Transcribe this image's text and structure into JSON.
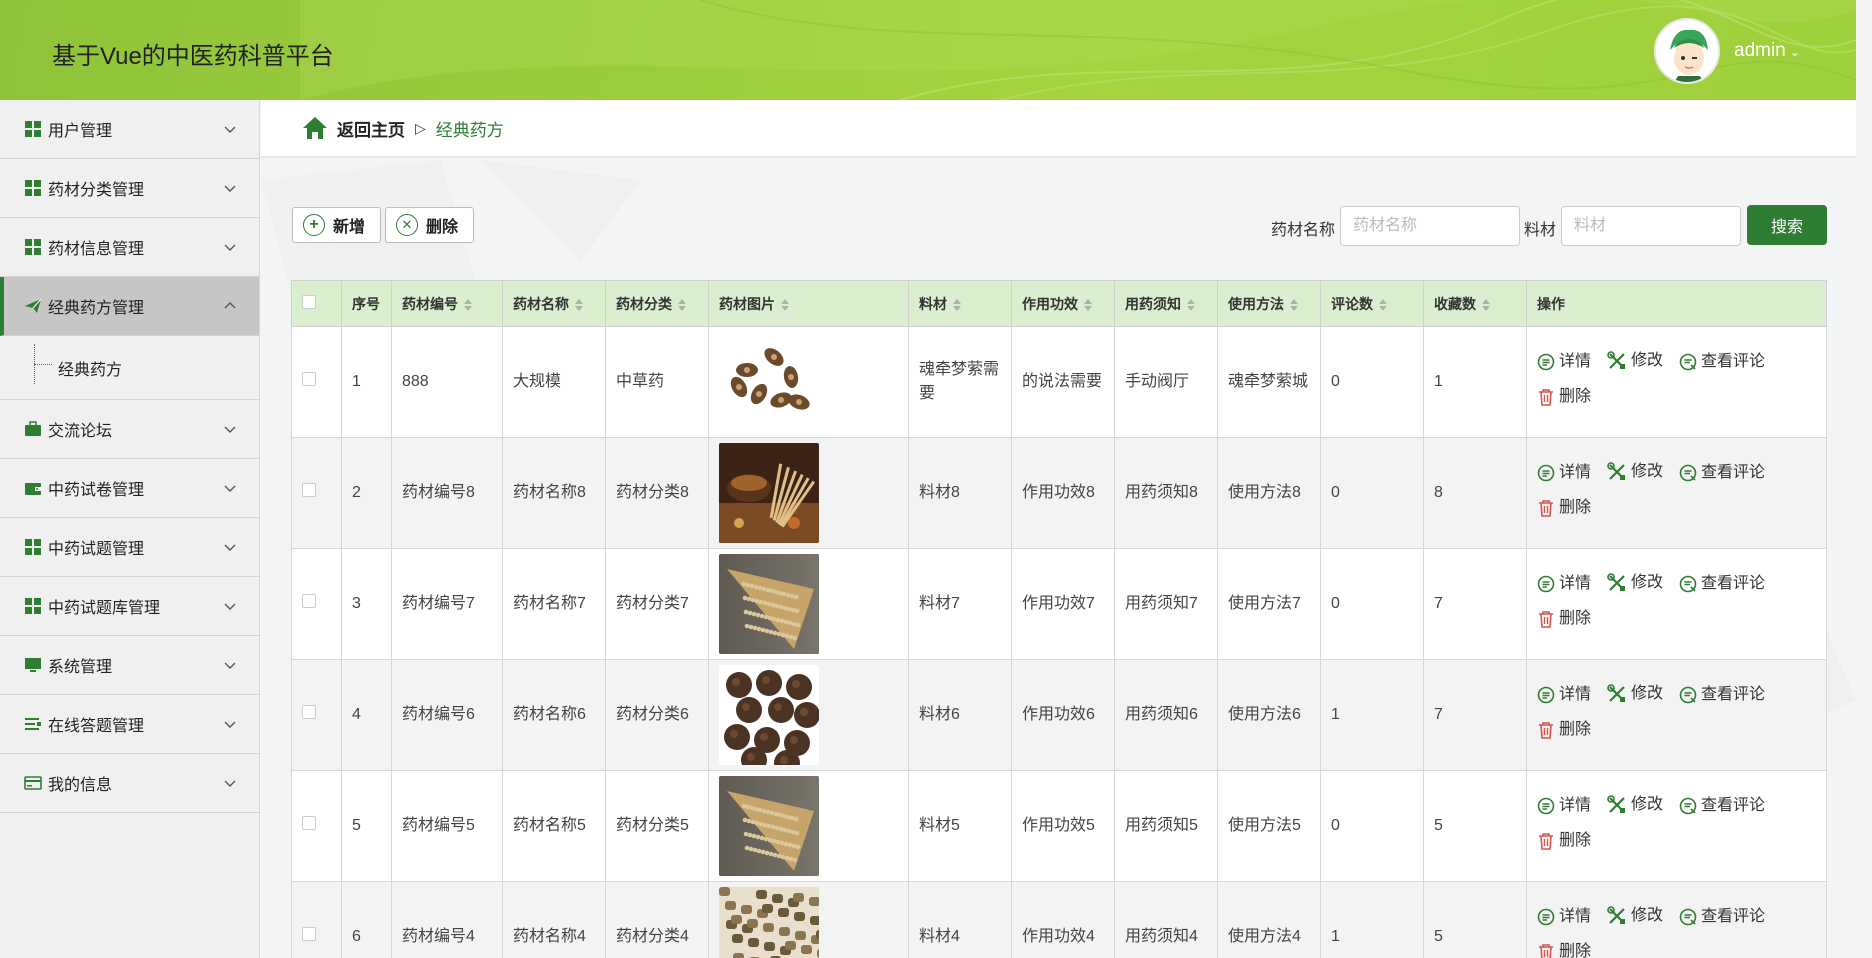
{
  "header": {
    "title": "基于Vue的中医药科普平台",
    "username": "admin"
  },
  "sidebar": {
    "items": [
      {
        "label": "用户管理",
        "icon": "grid-icon"
      },
      {
        "label": "药材分类管理",
        "icon": "grid-icon"
      },
      {
        "label": "药材信息管理",
        "icon": "grid-icon"
      },
      {
        "label": "经典药方管理",
        "icon": "send-icon",
        "active": true
      },
      {
        "label": "交流论坛",
        "icon": "briefcase-icon"
      },
      {
        "label": "中药试卷管理",
        "icon": "wallet-icon"
      },
      {
        "label": "中药试题管理",
        "icon": "grid-icon"
      },
      {
        "label": "中药试题库管理",
        "icon": "grid-icon"
      },
      {
        "label": "系统管理",
        "icon": "monitor-icon"
      },
      {
        "label": "在线答题管理",
        "icon": "list-icon"
      },
      {
        "label": "我的信息",
        "icon": "card-icon"
      }
    ],
    "submenu_label": "经典药方"
  },
  "breadcrumb": {
    "home": "返回主页",
    "current": "经典药方"
  },
  "toolbar": {
    "add_label": "新增",
    "delete_label": "删除"
  },
  "search": {
    "name_label": "药材名称",
    "name_placeholder": "药材名称",
    "material_label": "料材",
    "material_placeholder": "料材",
    "button_label": "搜索"
  },
  "table": {
    "headers": [
      "序号",
      "药材编号",
      "药材名称",
      "药材分类",
      "药材图片",
      "料材",
      "作用功效",
      "用药须知",
      "使用方法",
      "评论数",
      "收藏数",
      "操作"
    ],
    "actions": {
      "detail": "详情",
      "edit": "修改",
      "comments": "查看评论",
      "delete": "删除"
    },
    "rows": [
      {
        "index": "1",
        "code": "888",
        "name": "大规模",
        "category": "中草药",
        "image": "star-anise",
        "material": "魂牵梦萦需要",
        "effect": "的说法需要",
        "notice": "手动阀厅",
        "usage": "魂牵梦萦城",
        "comments": "0",
        "favorites": "1"
      },
      {
        "index": "2",
        "code": "药材编号8",
        "name": "药材名称8",
        "category": "药材分类8",
        "image": "herbs-bowl",
        "material": "料材8",
        "effect": "作用功效8",
        "notice": "用药须知8",
        "usage": "使用方法8",
        "comments": "0",
        "favorites": "8"
      },
      {
        "index": "3",
        "code": "药材编号7",
        "name": "药材名称7",
        "category": "药材分类7",
        "image": "seeds-scoop",
        "material": "料材7",
        "effect": "作用功效7",
        "notice": "用药须知7",
        "usage": "使用方法7",
        "comments": "0",
        "favorites": "7"
      },
      {
        "index": "4",
        "code": "药材编号6",
        "name": "药材名称6",
        "category": "药材分类6",
        "image": "dried-balls",
        "material": "料材6",
        "effect": "作用功效6",
        "notice": "用药须知6",
        "usage": "使用方法6",
        "comments": "1",
        "favorites": "7"
      },
      {
        "index": "5",
        "code": "药材编号5",
        "name": "药材名称5",
        "category": "药材分类5",
        "image": "seeds-scoop",
        "material": "料材5",
        "effect": "作用功效5",
        "notice": "用药须知5",
        "usage": "使用方法5",
        "comments": "0",
        "favorites": "5"
      },
      {
        "index": "6",
        "code": "药材编号4",
        "name": "药材名称4",
        "category": "药材分类4",
        "image": "dried-chunks",
        "material": "料材4",
        "effect": "作用功效4",
        "notice": "用药须知4",
        "usage": "使用方法4",
        "comments": "1",
        "favorites": "5"
      }
    ]
  },
  "colors": {
    "header_green": "#9ccc3c",
    "accent_green": "#2e7d32",
    "table_header_bg": "#d9efcf"
  }
}
